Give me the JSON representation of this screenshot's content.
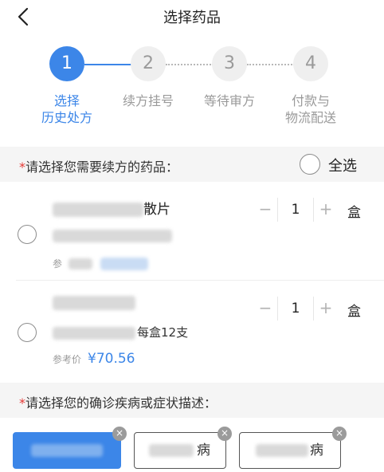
{
  "header": {
    "title": "选择药品",
    "back_icon": "chevron-left-icon"
  },
  "steps": [
    {
      "number": "1",
      "label_line1": "选择",
      "label_line2": "历史处方",
      "active": true
    },
    {
      "number": "2",
      "label_line1": "续方挂号",
      "label_line2": "",
      "active": false
    },
    {
      "number": "3",
      "label_line1": "等待审方",
      "label_line2": "",
      "active": false
    },
    {
      "number": "4",
      "label_line1": "付款与",
      "label_line2": "物流配送",
      "active": false
    }
  ],
  "drug_section": {
    "required_mark": "*",
    "prompt": "请选择您需要续方的药品：",
    "select_all_label": "全选"
  },
  "drugs": [
    {
      "name_suffix": "散片",
      "spec_suffix": "",
      "ref_label": "参",
      "price": "",
      "qty": "1",
      "unit": "盒"
    },
    {
      "name_suffix": "",
      "spec_suffix": "每盒12支",
      "ref_label": "参考价",
      "price": "¥70.56",
      "qty": "1",
      "unit": "盒"
    }
  ],
  "stepper": {
    "minus": "−",
    "plus": "+"
  },
  "diagnosis_section": {
    "required_mark": "*",
    "prompt": "请选择您的确诊疾病或症状描述："
  },
  "tags": [
    {
      "text_suffix": "",
      "selected": true
    },
    {
      "text_suffix": "病",
      "selected": false
    },
    {
      "text_suffix": "病",
      "selected": false
    }
  ],
  "tag_remove_icon": "×",
  "colors": {
    "accent": "#3c86e8",
    "required": "#e53935",
    "muted": "#9a9a9a"
  }
}
